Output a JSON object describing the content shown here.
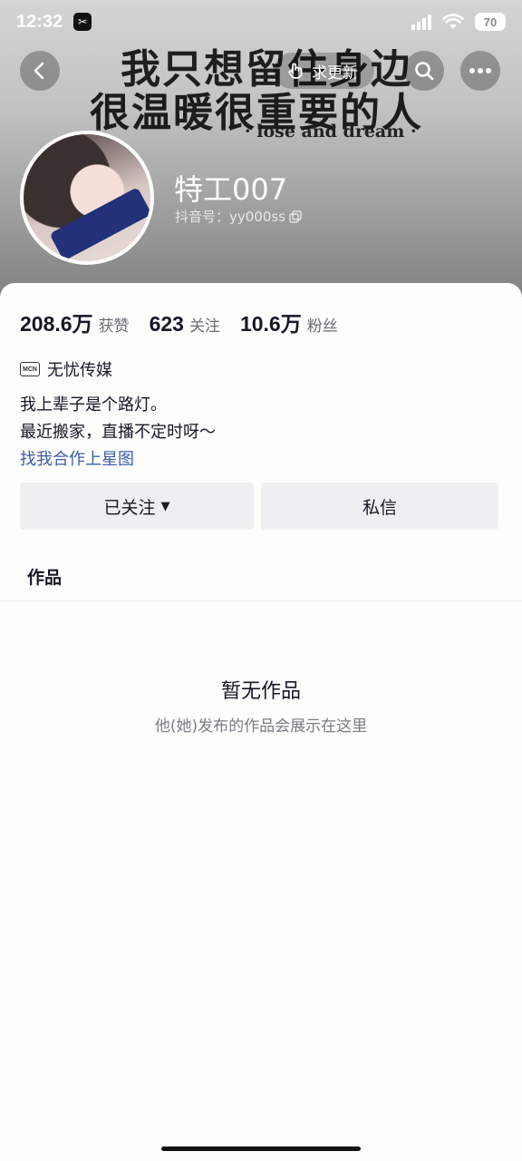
{
  "status_bar": {
    "time": "12:32",
    "app_badge": "✂",
    "battery": "70"
  },
  "banner": {
    "line1": "我只想留住身边",
    "line2": "很温暖很重要的人",
    "line3": "· lose and dream ·"
  },
  "header": {
    "update_label": "求更新"
  },
  "profile": {
    "nickname": "特工007",
    "douyin_id": "抖音号：yy000ss"
  },
  "stats": [
    {
      "value": "208.6万",
      "label": "获赞"
    },
    {
      "value": "623",
      "label": "关注"
    },
    {
      "value": "10.6万",
      "label": "粉丝"
    }
  ],
  "mcn": {
    "badge": "MCN",
    "name": "无忧传媒"
  },
  "bio": {
    "line1": "我上辈子是个路灯。",
    "line2": "最近搬家，直播不定时呀～",
    "collab_link": "找我合作上星图"
  },
  "actions": {
    "followed_label": "已关注",
    "message_label": "私信"
  },
  "tabs": {
    "works": "作品"
  },
  "empty_state": {
    "title": "暂无作品",
    "subtitle": "他(她)发布的作品会展示在这里"
  }
}
